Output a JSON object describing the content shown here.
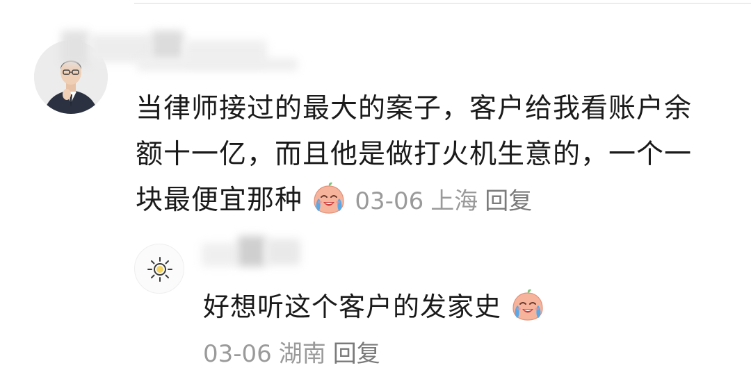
{
  "comment": {
    "text_line1": "当律师接过的最大的案子，客户给我看账户余",
    "text_line2": "额十一亿，而且他是做打火机生意的，一个一",
    "text_line3": "块最便宜那种",
    "emoji": "crying-laughing-emoji",
    "date": "03-06",
    "location": "上海",
    "reply_label": "回复"
  },
  "reply": {
    "text": "好想听这个客户的发家史",
    "emoji": "crying-laughing-emoji",
    "date": "03-06",
    "location": "湖南",
    "reply_label": "回复"
  },
  "colors": {
    "text": "#1a1a1a",
    "meta": "#9a9a9a",
    "emoji_face": "#f6b29a",
    "emoji_tear": "#5aa9e6"
  }
}
